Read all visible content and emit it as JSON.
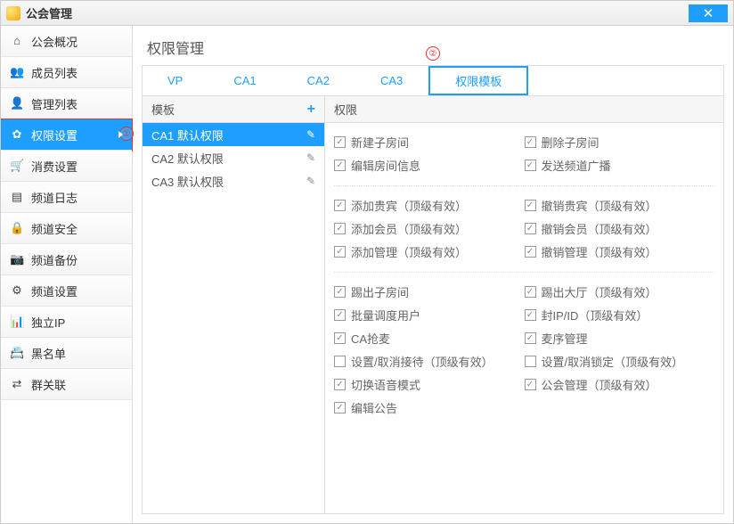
{
  "window": {
    "title": "公会管理"
  },
  "sidebar": {
    "items": [
      {
        "label": "公会概况",
        "icon": "⌂"
      },
      {
        "label": "成员列表",
        "icon": "👥"
      },
      {
        "label": "管理列表",
        "icon": "👤"
      },
      {
        "label": "权限设置",
        "icon": "✿",
        "active": true
      },
      {
        "label": "消费设置",
        "icon": "🛒"
      },
      {
        "label": "频道日志",
        "icon": "▤"
      },
      {
        "label": "频道安全",
        "icon": "🔒"
      },
      {
        "label": "频道备份",
        "icon": "📷"
      },
      {
        "label": "频道设置",
        "icon": "⚙"
      },
      {
        "label": "独立IP",
        "icon": "📊"
      },
      {
        "label": "黑名单",
        "icon": "📇"
      },
      {
        "label": "群关联",
        "icon": "⇄"
      }
    ]
  },
  "page": {
    "title": "权限管理"
  },
  "tabs": [
    {
      "label": "VP"
    },
    {
      "label": "CA1"
    },
    {
      "label": "CA2"
    },
    {
      "label": "CA3"
    },
    {
      "label": "权限模板",
      "active": true
    }
  ],
  "callouts": {
    "one": "①",
    "two": "②"
  },
  "templates": {
    "header": "模板",
    "items": [
      {
        "label": "CA1 默认权限",
        "selected": true
      },
      {
        "label": "CA2 默认权限"
      },
      {
        "label": "CA3 默认权限"
      }
    ]
  },
  "permissions": {
    "header": "权限",
    "groups": [
      [
        {
          "label": "新建子房间",
          "checked": true
        },
        {
          "label": "删除子房间",
          "checked": true
        },
        {
          "label": "编辑房间信息",
          "checked": true
        },
        {
          "label": "发送频道广播",
          "checked": true
        }
      ],
      [
        {
          "label": "添加贵宾（顶级有效）",
          "checked": true
        },
        {
          "label": "撤销贵宾（顶级有效）",
          "checked": true
        },
        {
          "label": "添加会员（顶级有效）",
          "checked": true
        },
        {
          "label": "撤销会员（顶级有效）",
          "checked": true
        },
        {
          "label": "添加管理（顶级有效）",
          "checked": true
        },
        {
          "label": "撤销管理（顶级有效）",
          "checked": true
        }
      ],
      [
        {
          "label": "踢出子房间",
          "checked": true
        },
        {
          "label": "踢出大厅（顶级有效）",
          "checked": true
        },
        {
          "label": "批量调度用户",
          "checked": true
        },
        {
          "label": "封IP/ID（顶级有效）",
          "checked": true
        },
        {
          "label": "CA抢麦",
          "checked": true
        },
        {
          "label": "麦序管理",
          "checked": true
        },
        {
          "label": "设置/取消接待（顶级有效）",
          "checked": false
        },
        {
          "label": "设置/取消锁定（顶级有效）",
          "checked": false
        },
        {
          "label": "切换语音模式",
          "checked": true
        },
        {
          "label": "公会管理（顶级有效）",
          "checked": true
        },
        {
          "label": "编辑公告",
          "checked": true
        }
      ]
    ]
  }
}
